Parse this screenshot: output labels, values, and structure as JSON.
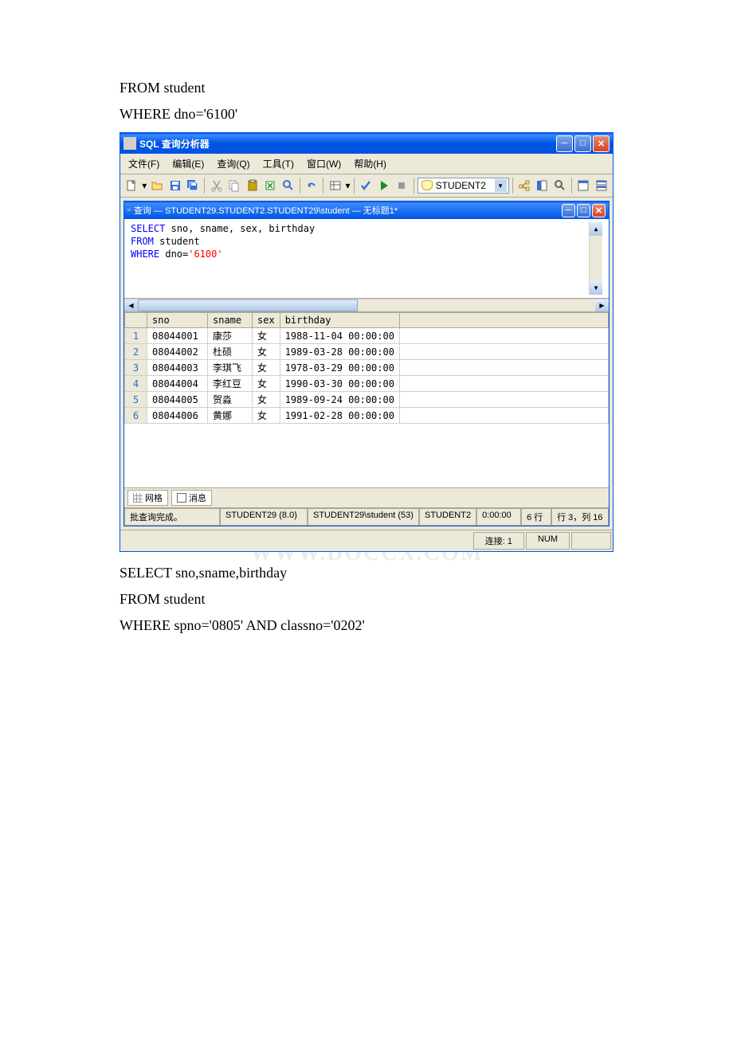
{
  "page_text": {
    "line1": "FROM student",
    "line2": "WHERE dno='6100'",
    "line3": "SELECT sno,sname,birthday",
    "line4": "FROM student",
    "line5": "WHERE spno='0805' AND classno='0202'"
  },
  "window": {
    "title": "SQL 查询分析器",
    "menu": {
      "file": "文件(F)",
      "edit": "编辑(E)",
      "query": "查询(Q)",
      "tools": "工具(T)",
      "window": "窗口(W)",
      "help": "帮助(H)"
    },
    "toolbar": {
      "db_selected": "STUDENT2"
    },
    "inner_title": "查询 — STUDENT29.STUDENT2.STUDENT29\\student — 无标题1*",
    "sql": {
      "l1_kw": "SELECT",
      "l1_rest": " sno, sname, sex, birthday",
      "l2_kw": "FROM",
      "l2_rest": " student",
      "l3_kw": "WHERE",
      "l3_rest1": " dno=",
      "l3_str": "'6100'"
    },
    "columns": {
      "sno": "sno",
      "sname": "sname",
      "sex": "sex",
      "birthday": "birthday"
    },
    "rows": [
      {
        "n": "1",
        "sno": "08044001",
        "sname": "康莎",
        "sex": "女",
        "birthday": "1988-11-04 00:00:00"
      },
      {
        "n": "2",
        "sno": "08044002",
        "sname": "杜硕",
        "sex": "女",
        "birthday": "1989-03-28 00:00:00"
      },
      {
        "n": "3",
        "sno": "08044003",
        "sname": "李琪飞",
        "sex": "女",
        "birthday": "1978-03-29 00:00:00"
      },
      {
        "n": "4",
        "sno": "08044004",
        "sname": "李红豆",
        "sex": "女",
        "birthday": "1990-03-30 00:00:00"
      },
      {
        "n": "5",
        "sno": "08044005",
        "sname": "贺淼",
        "sex": "女",
        "birthday": "1989-09-24 00:00:00"
      },
      {
        "n": "6",
        "sno": "08044006",
        "sname": "黄娜",
        "sex": "女",
        "birthday": "1991-02-28 00:00:00"
      }
    ],
    "tabs": {
      "grid": "网格",
      "messages": "消息"
    },
    "status": {
      "complete": "批查询完成。",
      "server": "STUDENT29 (8.0)",
      "user": "STUDENT29\\student (53)",
      "db": "STUDENT2",
      "time": "0:00:00",
      "rows": "6 行",
      "pos": "行 3，列 16"
    },
    "bottom_status": {
      "connections": "连接: 1",
      "numlock": "NUM"
    },
    "watermark": "WWW.DOCCX.COM"
  }
}
